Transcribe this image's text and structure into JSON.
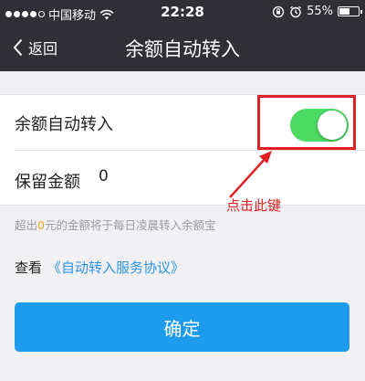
{
  "status_bar": {
    "carrier": "中国移动",
    "time": "22:28",
    "battery_percent": "55%",
    "battery_level": 0.55
  },
  "nav": {
    "back_label": "返回",
    "title": "余额自动转入"
  },
  "settings": {
    "auto_transfer_label": "余额自动转入",
    "auto_transfer_enabled": true,
    "reserve_label": "保留金额",
    "reserve_value": "0"
  },
  "annotation": {
    "text": "点击此键",
    "color": "#e02020"
  },
  "note": {
    "prefix": "超出",
    "amount": "0",
    "suffix": "元的金额将于每日凌晨转入余额宝"
  },
  "agreement": {
    "prefix": "查看",
    "link": "《自动转入服务协议》"
  },
  "confirm_label": "确定",
  "colors": {
    "bar_bg": "#2f2f35",
    "toggle_on": "#4cd964",
    "link": "#2b95e6",
    "button": "#1e9bea",
    "highlight_amount": "#f5a623"
  }
}
